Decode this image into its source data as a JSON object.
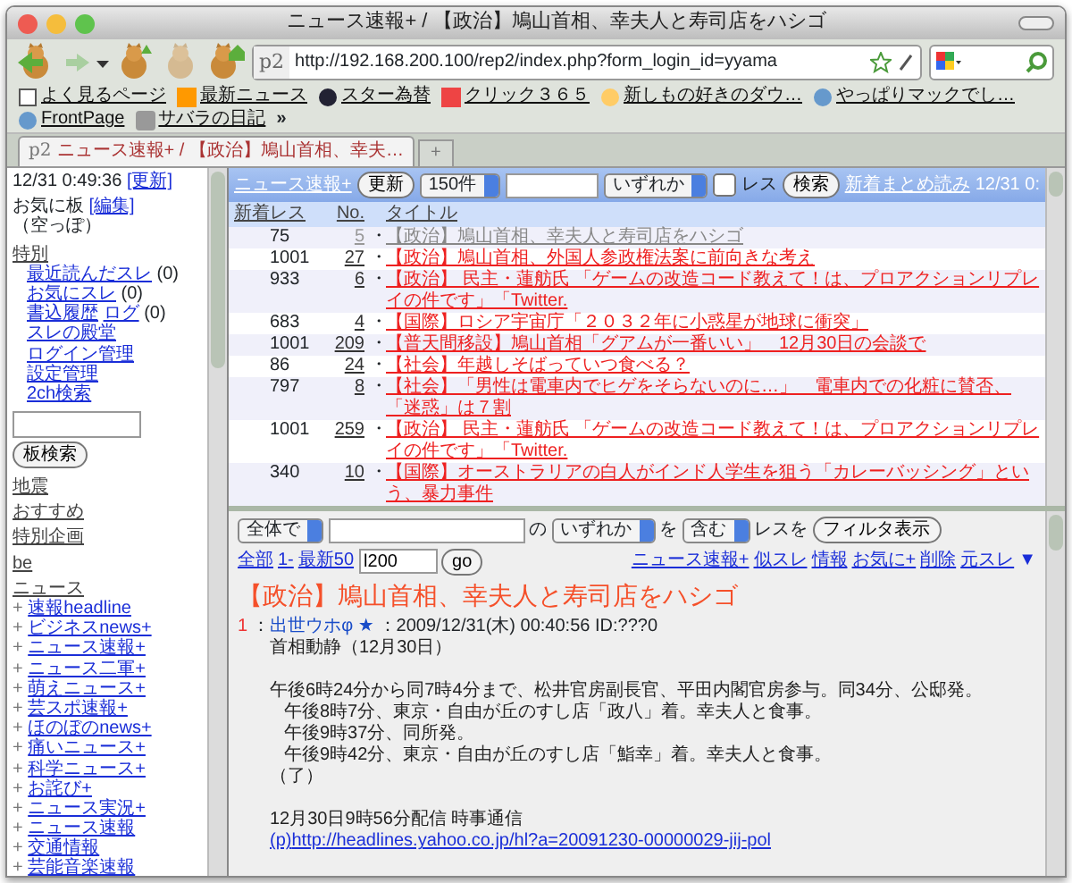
{
  "window": {
    "title": "ニュース速報+ / 【政治】鳩山首相、幸夫人と寿司店をハシゴ"
  },
  "toolbar": {
    "url_prefix": "p2",
    "url": "http://192.168.200.100/rep2/index.php?form_login_id=yyama"
  },
  "bookmarks": [
    {
      "label": "よく見るページ"
    },
    {
      "label": "最新ニュース"
    },
    {
      "label": "スター為替"
    },
    {
      "label": "クリック３６５"
    },
    {
      "label": "新しもの好きのダウ…"
    },
    {
      "label": "やっぱりマックでし…"
    },
    {
      "label": "FrontPage"
    },
    {
      "label": "サバラの日記"
    }
  ],
  "bookmarks_more": "»",
  "tabs": [
    {
      "prefix": "p2",
      "label": "ニュース速報+ / 【政治】鳩山首相、幸夫…",
      "selected": true
    }
  ],
  "new_tab": "+",
  "sidebar": {
    "time": "12/31 0:49:36",
    "refresh": "[更新]",
    "favorites_label": "お気に板",
    "favorites_edit": "[編集]",
    "favorites_empty": "（空っぽ）",
    "special_heading": "特別",
    "special_items": [
      {
        "label": "最近読んだスレ",
        "count": "(0)"
      },
      {
        "label": "お気にスレ",
        "count": "(0)"
      },
      {
        "label": "書込履歴",
        "extra": "ログ",
        "count": "(0)"
      },
      {
        "label": "スレの殿堂"
      },
      {
        "label": "ログイン管理"
      },
      {
        "label": "設定管理"
      },
      {
        "label": "2ch検索"
      }
    ],
    "board_search_button": "板検索",
    "categories": [
      "地震",
      "おすすめ",
      "特別企画",
      "be"
    ],
    "news_heading": "ニュース",
    "news_items": [
      {
        "toggle": "+",
        "label": "速報headline"
      },
      {
        "toggle": "+",
        "label": "ビジネスnews+"
      },
      {
        "toggle": "+",
        "label": "ニュース速報+"
      },
      {
        "toggle": "+",
        "label": "ニュース二軍+"
      },
      {
        "toggle": "+",
        "label": "萌えニュース+"
      },
      {
        "toggle": "+",
        "label": "芸スポ速報+"
      },
      {
        "toggle": "+",
        "label": "ほのぼのnews+"
      },
      {
        "toggle": "+",
        "label": "痛いニュース+"
      },
      {
        "toggle": "+",
        "label": "科学ニュース+"
      },
      {
        "toggle": "+",
        "label": "お詫び+"
      },
      {
        "toggle": "+",
        "label": "ニュース実況+"
      },
      {
        "toggle": "+",
        "label": "ニュース速報"
      },
      {
        "toggle": "+",
        "label": "交通情報"
      },
      {
        "toggle": "+",
        "label": "芸能音楽速報"
      }
    ]
  },
  "thread_list": {
    "board": "ニュース速報+",
    "refresh_button": "更新",
    "count_select": "150件",
    "match_select": "いずれか",
    "res_checkbox": {
      "label": "レス",
      "checked": false
    },
    "search_button": "検索",
    "read_new": "新着まとめ読み",
    "time": "12/31 0:",
    "columns": [
      "新着",
      "レス",
      "No.",
      "タイトル"
    ],
    "rows": [
      {
        "res": "75",
        "no": "5",
        "bullet": "・",
        "title": "【政治】鳩山首相、幸夫人と寿司店をハシゴ",
        "read": true
      },
      {
        "res": "1001",
        "no": "27",
        "bullet": "・",
        "title": "【政治】鳩山首相、外国人参政権法案に前向きな考え",
        "read": false
      },
      {
        "res": "933",
        "no": "6",
        "bullet": "・",
        "title": "【政治】 民主・蓮舫氏 「ゲームの改造コード教えて！は、プロアクションリプレイの件です」「Twitter.",
        "read": false
      },
      {
        "res": "683",
        "no": "4",
        "bullet": "・",
        "title": "【国際】ロシア宇宙庁「２０３２年に小惑星が地球に衝突」",
        "read": false
      },
      {
        "res": "1001",
        "no": "209",
        "bullet": "・",
        "title": "【普天間移設】鳩山首相「グアムが一番いい」　12月30日の会談で",
        "read": false
      },
      {
        "res": "86",
        "no": "24",
        "bullet": "・",
        "title": "【社会】年越しそばっていつ食べる？",
        "read": false
      },
      {
        "res": "797",
        "no": "8",
        "bullet": "・",
        "title": "【社会】「男性は電車内でヒゲをそらないのに…」　電車内での化粧に賛否、「迷惑」は７割",
        "read": false
      },
      {
        "res": "1001",
        "no": "259",
        "bullet": "・",
        "title": "【政治】 民主・蓮舫氏 「ゲームの改造コード教えて！は、プロアクションリプレイの件です」「Twitter.",
        "read": false
      },
      {
        "res": "340",
        "no": "10",
        "bullet": "・",
        "title": "【国際】オーストラリアの白人がインド人学生を狙う「カレーバッシング」という、暴力事件",
        "read": false
      }
    ]
  },
  "thread": {
    "filter": {
      "scope_select": "全体で",
      "of": "の",
      "match_select": "いずれか",
      "wo": "を",
      "mode_select": "含む",
      "res_wo": "レスを",
      "button": "フィルタ表示"
    },
    "nav_left": [
      "全部",
      "1-",
      "最新50"
    ],
    "range_value": "l200",
    "go_button": "go",
    "nav_right": [
      "ニュース速報+",
      "似スレ",
      "情報",
      "お気に+",
      "削除",
      "元スレ"
    ],
    "nav_down": "▼",
    "title": "【政治】鳩山首相、幸夫人と寿司店をハシゴ",
    "post": {
      "number": "1",
      "sep": "：",
      "name": "出世ウホφ ★",
      "meta": "：2009/12/31(木) 00:40:56 ID:???0",
      "lines": [
        {
          "text": "首相動静（12月30日）",
          "indent": false,
          "gap_before": false
        },
        {
          "text": "午後6時24分から同7時4分まで、松井官房副長官、平田内閣官房参与。同34分、公邸発。",
          "indent": false,
          "gap_before": true
        },
        {
          "text": "午後8時7分、東京・自由が丘のすし店「政八」着。幸夫人と食事。",
          "indent": true,
          "gap_before": false
        },
        {
          "text": "午後9時37分、同所発。",
          "indent": true,
          "gap_before": false
        },
        {
          "text": "午後9時42分、東京・自由が丘のすし店「鮨幸」着。幸夫人と食事。",
          "indent": true,
          "gap_before": false
        },
        {
          "text": "（了）",
          "indent": false,
          "gap_before": false
        },
        {
          "text": "12月30日9時56分配信 時事通信",
          "indent": false,
          "gap_before": true
        }
      ],
      "link_prefix": "(p)",
      "link": "http://headlines.yahoo.co.jp/hl?a=20091230-00000029-jij-pol"
    }
  }
}
